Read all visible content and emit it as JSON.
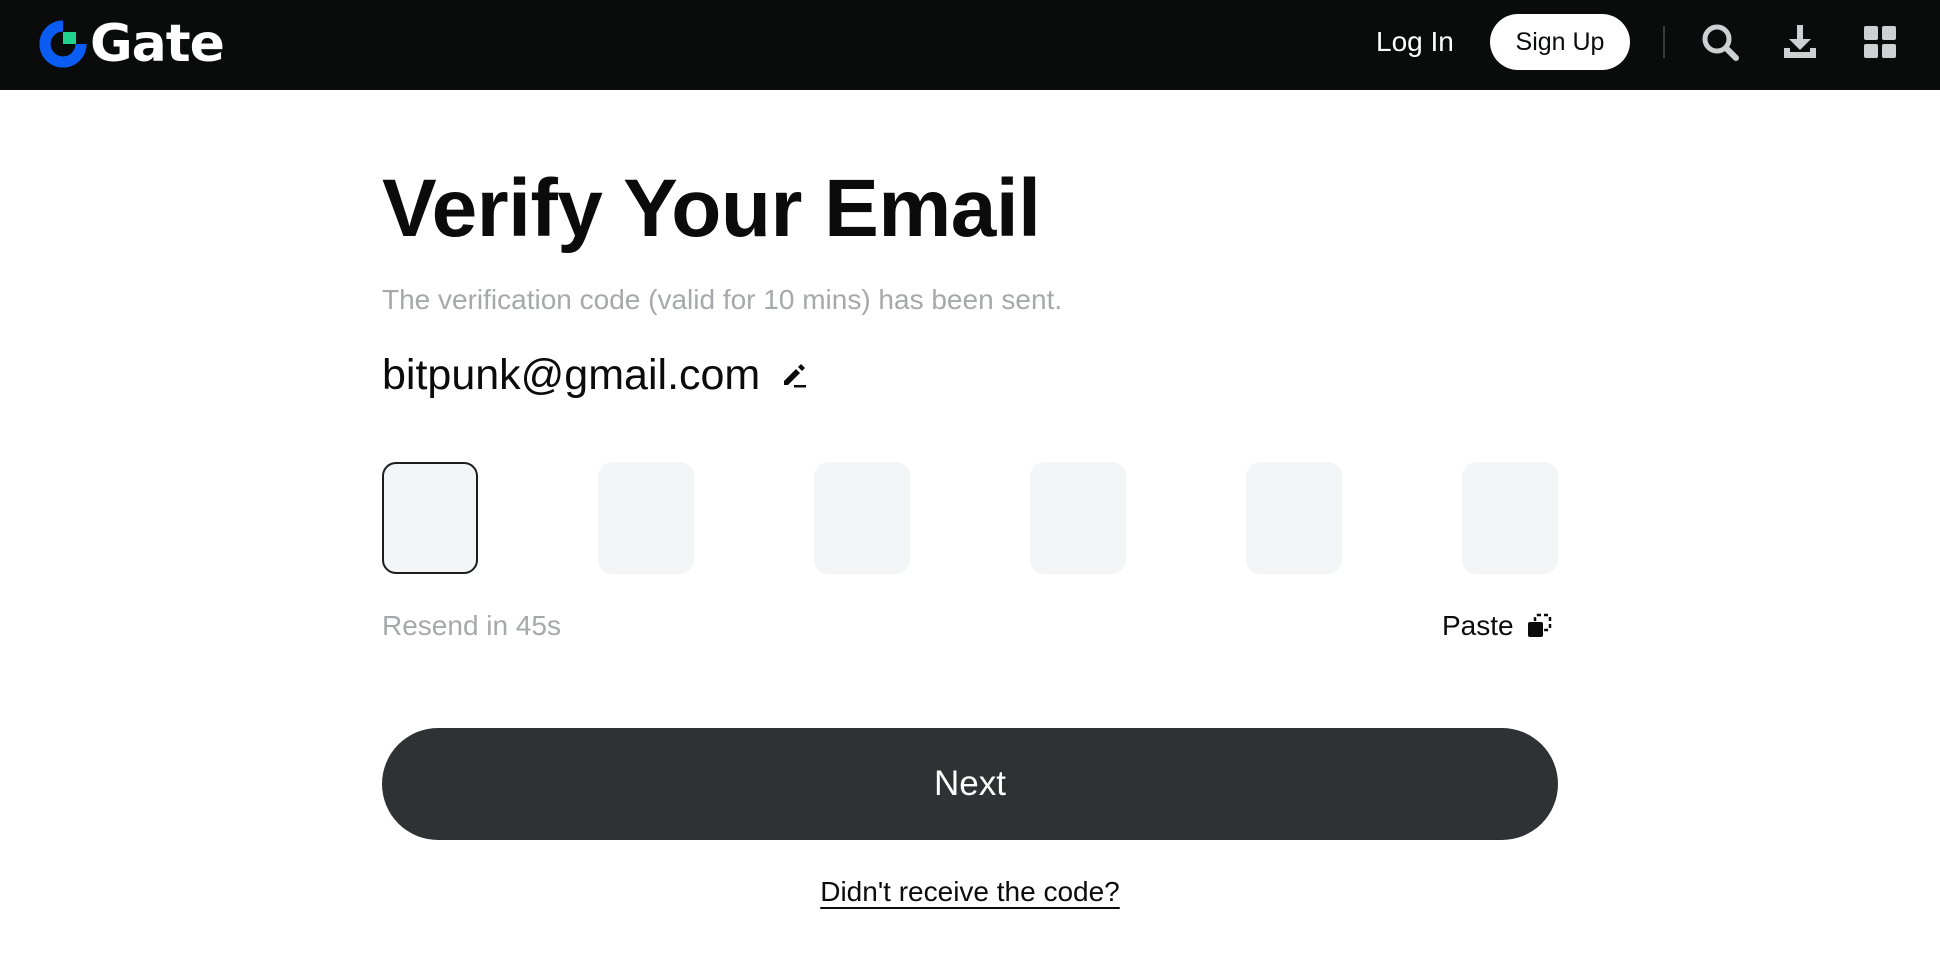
{
  "header": {
    "logo_text": "Gate",
    "login_label": "Log In",
    "signup_label": "Sign Up",
    "icons": [
      "search-icon",
      "download-icon",
      "apps-grid-icon"
    ]
  },
  "main": {
    "title": "Verify Your Email",
    "subtitle": "The verification code (valid for 10 mins) has been sent.",
    "email": "bitpunk@gmail.com",
    "code_length": 6,
    "active_box": 1,
    "resend_text": "Resend in 45s",
    "paste_label": "Paste",
    "next_label": "Next",
    "help_link": "Didn't receive the code?"
  },
  "colors": {
    "topbar": "#0a0b0b",
    "logo_blue": "#0b5cf2",
    "logo_green": "#20d18f",
    "button_dark": "#303134",
    "muted_text": "#a7a8ab",
    "code_box_bg": "#f4f5f6"
  }
}
